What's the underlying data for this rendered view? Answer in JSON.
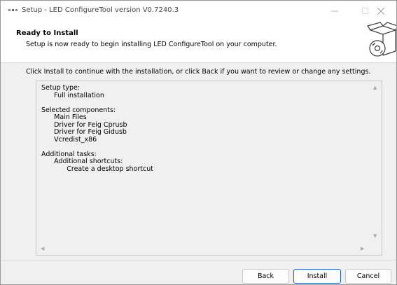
{
  "window": {
    "title": "Setup - LED ConfigureTool version V0.7240.3"
  },
  "header": {
    "title": "Ready to Install",
    "subtitle": "Setup is now ready to begin installing LED ConfigureTool on your computer."
  },
  "body": {
    "instructions": "Click Install to continue with the installation, or click Back if you want to review or change any settings.",
    "memo_lines": [
      "Setup type:",
      "      Full installation",
      "",
      "Selected components:",
      "      Main Files",
      "      Driver for Feig Cprusb",
      "      Driver for Feig Gidusb",
      "      Vcredist_x86",
      "",
      "Additional tasks:",
      "      Additional shortcuts:",
      "            Create a desktop shortcut"
    ]
  },
  "buttons": {
    "back": "Back",
    "install": "Install",
    "cancel": "Cancel"
  },
  "icons": {
    "app": "setup-app-icon",
    "header": "install-box-cd-icon",
    "minimize": "minimize-icon",
    "maximize": "maximize-icon",
    "close": "close-icon"
  },
  "colors": {
    "default_button_border": "#1a62c8",
    "dialog_background": "#f0f0f0"
  }
}
